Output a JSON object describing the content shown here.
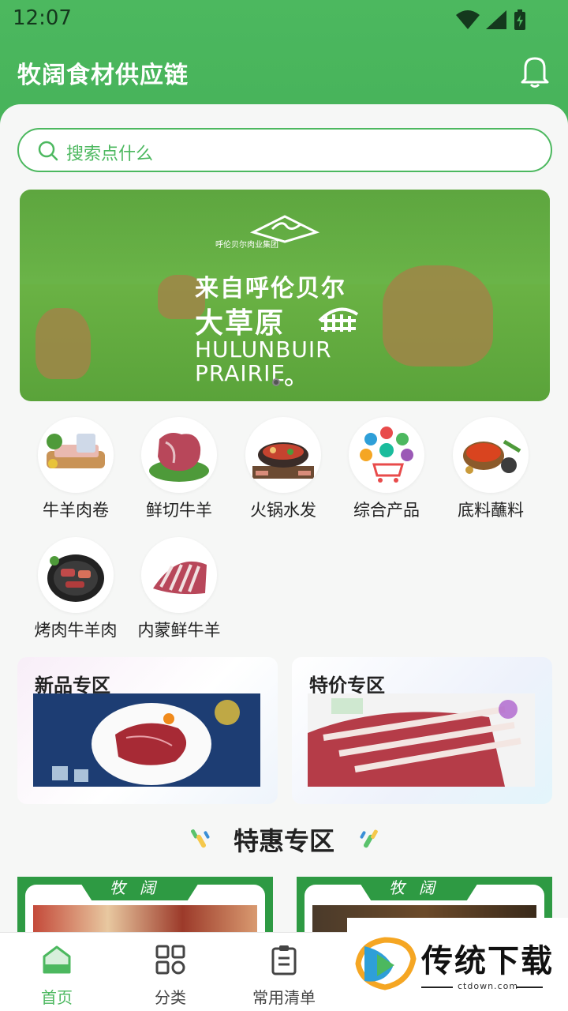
{
  "status": {
    "time": "12:07"
  },
  "header": {
    "title": "牧阔食材供应链"
  },
  "search": {
    "placeholder": "搜索点什么"
  },
  "banner": {
    "brand": "呼伦贝尔肉业集团",
    "line1": "来自呼伦贝尔",
    "line2": "大草原",
    "en1": "HULUNBUIR",
    "en2": "PRAIRIE",
    "slide_count": 2,
    "active_slide": 1
  },
  "categories": [
    {
      "label": "牛羊肉卷",
      "icon": "meat-roll-icon"
    },
    {
      "label": "鲜切牛羊",
      "icon": "fresh-meat-icon"
    },
    {
      "label": "火锅水发",
      "icon": "hotpot-icon"
    },
    {
      "label": "综合产品",
      "icon": "products-icon"
    },
    {
      "label": "底料蘸料",
      "icon": "spices-icon"
    },
    {
      "label": "烤肉牛羊肉",
      "icon": "bbq-icon"
    },
    {
      "label": "内蒙鲜牛羊",
      "icon": "lamb-rack-icon"
    }
  ],
  "promos": [
    {
      "title": "新品专区"
    },
    {
      "title": "特价专区"
    }
  ],
  "section": {
    "title": "特惠专区"
  },
  "deals": [
    {
      "tag": "牧阔"
    },
    {
      "tag": "牧阔"
    }
  ],
  "tabs": [
    {
      "label": "首页",
      "active": true
    },
    {
      "label": "分类",
      "active": false
    },
    {
      "label": "常用清单",
      "active": false
    }
  ],
  "watermark": {
    "name": "传统下载",
    "url": "ctdown.com"
  },
  "colors": {
    "primary": "#4cb85f",
    "deal_green": "#2e9a43"
  }
}
